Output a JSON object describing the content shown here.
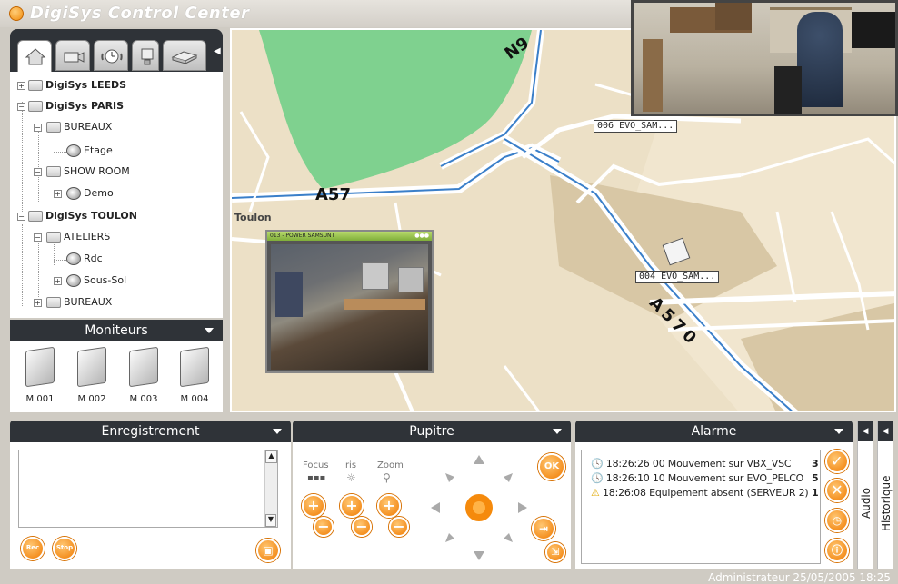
{
  "app": {
    "title": "DigiSys Control Center"
  },
  "tree": [
    {
      "label": "DigiSys LEEDS",
      "bold": true
    },
    {
      "label": "DigiSys PARIS",
      "bold": true
    },
    {
      "label": "BUREAUX"
    },
    {
      "label": "Etage"
    },
    {
      "label": "SHOW ROOM"
    },
    {
      "label": "Demo"
    },
    {
      "label": "DigiSys TOULON",
      "bold": true
    },
    {
      "label": "ATELIERS"
    },
    {
      "label": "Rdc"
    },
    {
      "label": "Sous-Sol"
    },
    {
      "label": "BUREAUX"
    }
  ],
  "moniteurs": {
    "title": "Moniteurs",
    "items": [
      "M 001",
      "M 002",
      "M 003",
      "M 004"
    ]
  },
  "map": {
    "roads": [
      "A57",
      "A570",
      "N9"
    ],
    "city": "Toulon",
    "cameras": [
      "006 EVO_SAM...",
      "004 EVO_SAM..."
    ],
    "video_title": "013 - POWER SAMSUNT"
  },
  "enregistrement": {
    "title": "Enregistrement",
    "rec": "Rec",
    "stop": "Stop"
  },
  "pupitre": {
    "title": "Pupitre",
    "focus": "Focus",
    "iris": "Iris",
    "zoom": "Zoom",
    "ok": "OK"
  },
  "alarme": {
    "title": "Alarme",
    "items": [
      {
        "text": "18:26:26 00 Mouvement sur VBX_VSC",
        "count": "3",
        "icon": "clock-icon"
      },
      {
        "text": "18:26:10 10 Mouvement sur EVO_PELCO",
        "count": "5",
        "icon": "clock-icon"
      },
      {
        "text": "18:26:08 Equipement absent (SERVEUR 2)",
        "count": "1",
        "icon": "warning-icon"
      }
    ]
  },
  "side_tabs": {
    "audio": "Audio",
    "historique": "Historique"
  },
  "status": {
    "text": "Administrateur  25/05/2005  18:25"
  },
  "colors": {
    "accent": "#f08a0a",
    "panel_header": "#2f3338",
    "map_bg": "#ece0c6",
    "park": "#7fd18f",
    "highway": "#3a7fc9"
  }
}
